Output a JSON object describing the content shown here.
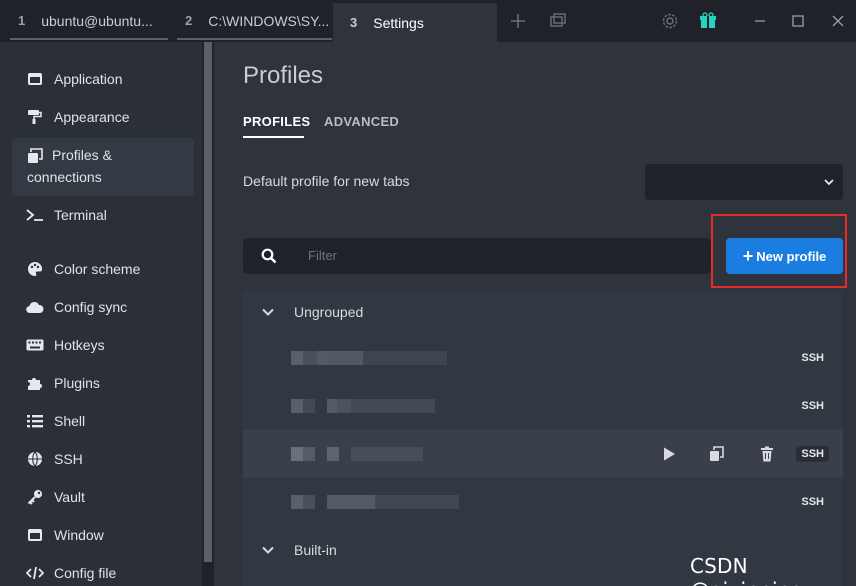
{
  "tabs": [
    {
      "num": "1",
      "title": "ubuntu@ubuntu..."
    },
    {
      "num": "2",
      "title": "C:\\WINDOWS\\SY..."
    },
    {
      "num": "3",
      "title": "Settings"
    }
  ],
  "sidebar": {
    "items": [
      {
        "label": "Application",
        "icon": "window-icon"
      },
      {
        "label": "Appearance",
        "icon": "paint-roller-icon"
      },
      {
        "label": "Profiles &",
        "label2": "connections",
        "icon": "window-restore-icon"
      },
      {
        "label": "Terminal",
        "icon": "terminal-icon"
      },
      {
        "label": "Color scheme",
        "icon": "palette-icon"
      },
      {
        "label": "Config sync",
        "icon": "cloud-icon"
      },
      {
        "label": "Hotkeys",
        "icon": "keyboard-icon"
      },
      {
        "label": "Plugins",
        "icon": "puzzle-icon"
      },
      {
        "label": "Shell",
        "icon": "list-icon"
      },
      {
        "label": "SSH",
        "icon": "globe-icon"
      },
      {
        "label": "Vault",
        "icon": "key-icon"
      },
      {
        "label": "Window",
        "icon": "window-icon"
      },
      {
        "label": "Config file",
        "icon": "code-icon"
      }
    ]
  },
  "main": {
    "title": "Profiles",
    "subtabs": [
      "PROFILES",
      "ADVANCED"
    ],
    "default_profile_label": "Default profile for new tabs",
    "default_profile_value": "",
    "filter_placeholder": "Filter",
    "new_profile_label": "New profile",
    "groups": [
      {
        "label": "Ungrouped"
      },
      {
        "label": "Built-in"
      }
    ],
    "rows": [
      {
        "badge": "SSH",
        "hover": false
      },
      {
        "badge": "SSH",
        "hover": false
      },
      {
        "badge": "SSH",
        "hover": true
      },
      {
        "badge": "SSH",
        "hover": false
      }
    ]
  },
  "watermark": "CSDN @aixinning",
  "colors": {
    "accent": "#1c7de0",
    "highlight_box": "#e52b2b",
    "gift_icon": "#2bd1c0"
  }
}
